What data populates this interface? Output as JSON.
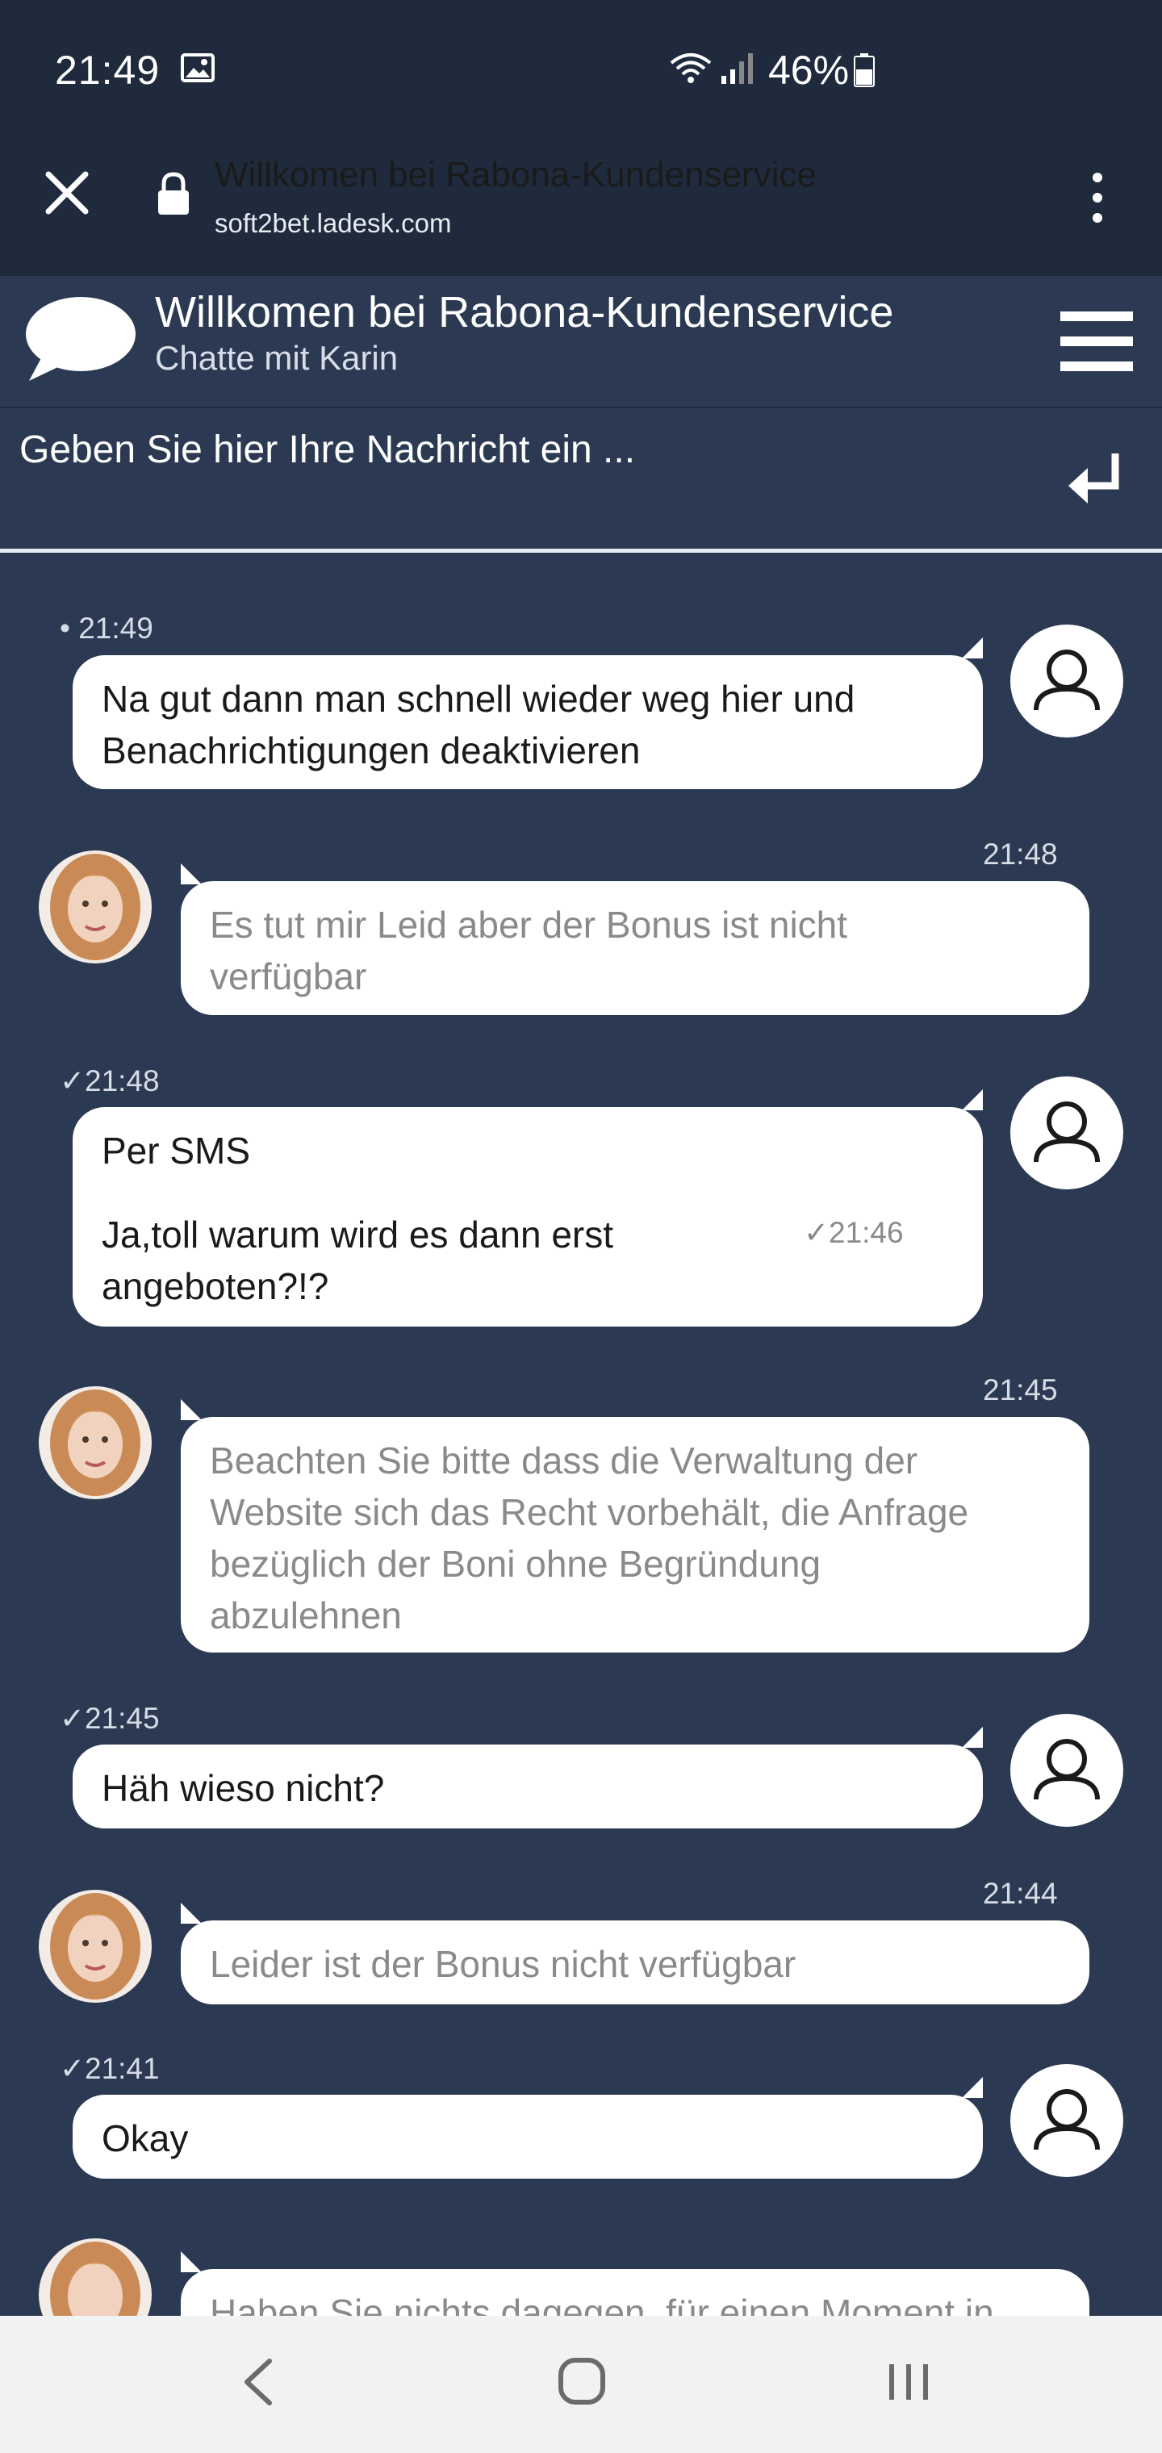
{
  "status_bar": {
    "time": "21:49",
    "battery": "46%"
  },
  "browser": {
    "title": "Willkomen bei Rabona-Kundenservice",
    "url": "soft2bet.ladesk.com"
  },
  "chat_header": {
    "title": "Willkomen bei Rabona-Kundenservice",
    "subtitle": "Chatte mit Karin"
  },
  "input": {
    "placeholder": "Geben Sie hier Ihre Nachricht ein ..."
  },
  "messages": [
    {
      "sender": "user",
      "time": "• 21:49",
      "lines": [
        "Na gut dann man schnell wieder weg hier und",
        "Benachrichtigungen deaktivieren"
      ]
    },
    {
      "sender": "agent",
      "time": "21:48",
      "lines": [
        "Es tut mir Leid aber der Bonus ist nicht",
        "verfügbar"
      ]
    },
    {
      "sender": "user",
      "time": "✓21:48",
      "lines": [
        "Per SMS"
      ],
      "second": {
        "lines": [
          "Ja,toll warum wird es dann erst",
          "angeboten?!?"
        ],
        "time": "✓21:46"
      }
    },
    {
      "sender": "agent",
      "time": "21:45",
      "lines": [
        "Beachten Sie bitte dass die Verwaltung der",
        "Website sich das Recht vorbehält, die Anfrage",
        "bezüglich der Boni ohne Begründung",
        "abzulehnen"
      ]
    },
    {
      "sender": "user",
      "time": "✓21:45",
      "lines": [
        "Häh wieso nicht?"
      ]
    },
    {
      "sender": "agent",
      "time": "21:44",
      "lines": [
        "Leider ist der Bonus nicht verfügbar"
      ]
    },
    {
      "sender": "user",
      "time": "✓21:41",
      "lines": [
        "Okay"
      ]
    },
    {
      "sender": "agent",
      "time": "",
      "lines": [
        "Haben Sie nichts dagegen, für einen Moment in"
      ]
    }
  ],
  "colors": {
    "background": "#2b3a52",
    "bar": "#1f2a3d",
    "agent_text": "#8a8a8a"
  }
}
